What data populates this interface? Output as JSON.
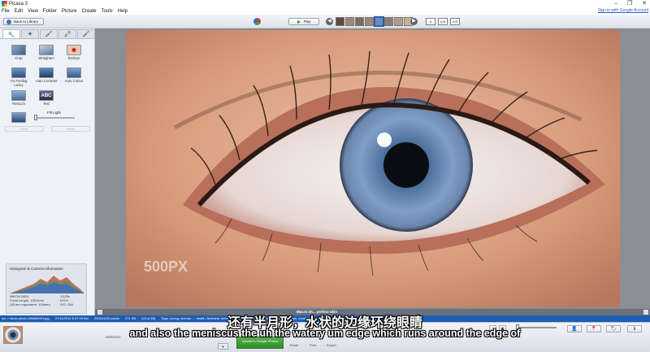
{
  "window": {
    "title": "Picasa 3",
    "controls": [
      "‒",
      "❐",
      "✕"
    ]
  },
  "menu": [
    "File",
    "Edit",
    "View",
    "Folder",
    "Picture",
    "Create",
    "Tools",
    "Help"
  ],
  "signin": "Sign in with Google Account",
  "toolbar": {
    "back_label": "Back to Library",
    "play_label": "Play",
    "caption_buttons": [
      "A",
      "A B",
      "A B"
    ]
  },
  "left_panel": {
    "tabs": [
      "🔧",
      "☀",
      "🖌",
      "🖍",
      "🖌"
    ],
    "tools": [
      {
        "label": "Crop"
      },
      {
        "label": "Straighten"
      },
      {
        "label": "Redeye"
      },
      {
        "label": "I'm Feeling Lucky"
      },
      {
        "label": "Auto Contrast"
      },
      {
        "label": "Auto Colour"
      },
      {
        "label": "Retouch"
      },
      {
        "label": "Text"
      }
    ],
    "fill_light_label": "Fill Light",
    "fill_light_value": 0,
    "undo_label": "Undo",
    "redo_label": "Redo",
    "histogram_title": "Histogram & Camera Information",
    "camera": {
      "model": "NIKON D810",
      "focal": "Focal Length: 105.0mm",
      "equiv": "(35 mm equivalent: 105mm)",
      "shutter": "1/125s",
      "aperture": "f/29.0",
      "iso": "ISO: 250"
    }
  },
  "photo": {
    "watermark": "500PX"
  },
  "status": {
    "path": "nvr > stock-photo-186450013.jpg",
    "date": "27/11/2014 6:47:49 AM",
    "dims": "2000x1125 pixels",
    "size": "271 KB",
    "index": "(23 of 65)",
    "tags": "Tags: young, woman, ... health, feminine, female, eyeshadows, eyelids, eyebrow, eyeliner, eye, creative, cosmetic, close-up, close, care, brow, beauty"
  },
  "caption_over": "Macro sh... perfect skin",
  "tray": {
    "selection_label": "Selection",
    "upload_label": "Upload to Google Photos",
    "email_label": "Email",
    "print_label": "Print",
    "export_label": "Export"
  },
  "subtitles": {
    "chinese": "还有半月形，水状的边缘环绕眼睛",
    "english": "and also the meniscus the uh the watery um edge which runs around the edge of"
  }
}
